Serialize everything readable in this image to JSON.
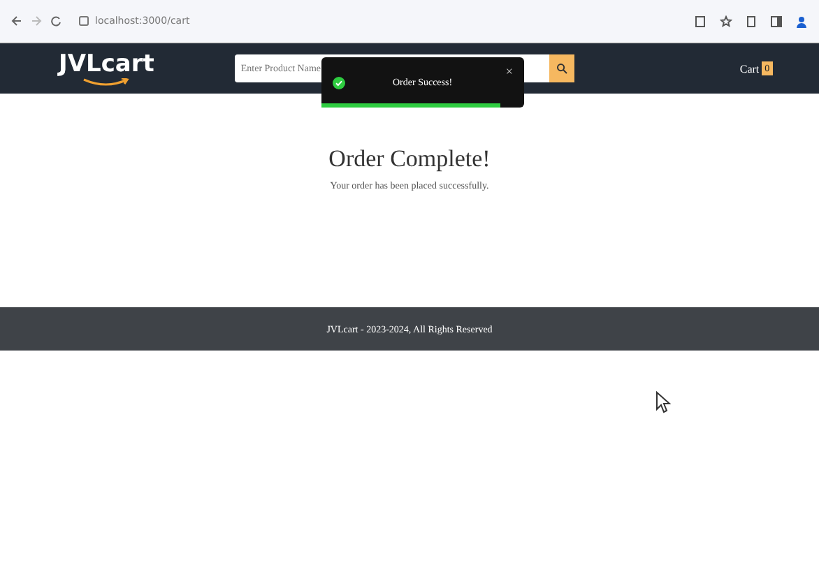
{
  "browser": {
    "url": "localhost:3000/cart"
  },
  "navbar": {
    "logo": "JVLcart",
    "search": {
      "placeholder": "Enter Product Name"
    },
    "cart": {
      "label": "Cart",
      "count": "0"
    }
  },
  "toast": {
    "message": "Order Success!",
    "close": "×",
    "level": 0.88
  },
  "content": {
    "title": "Order Complete!",
    "message": "Your order has been placed successfully."
  },
  "footer": {
    "text": "JVLcart - 2023-2024, All Rights Reserved"
  }
}
